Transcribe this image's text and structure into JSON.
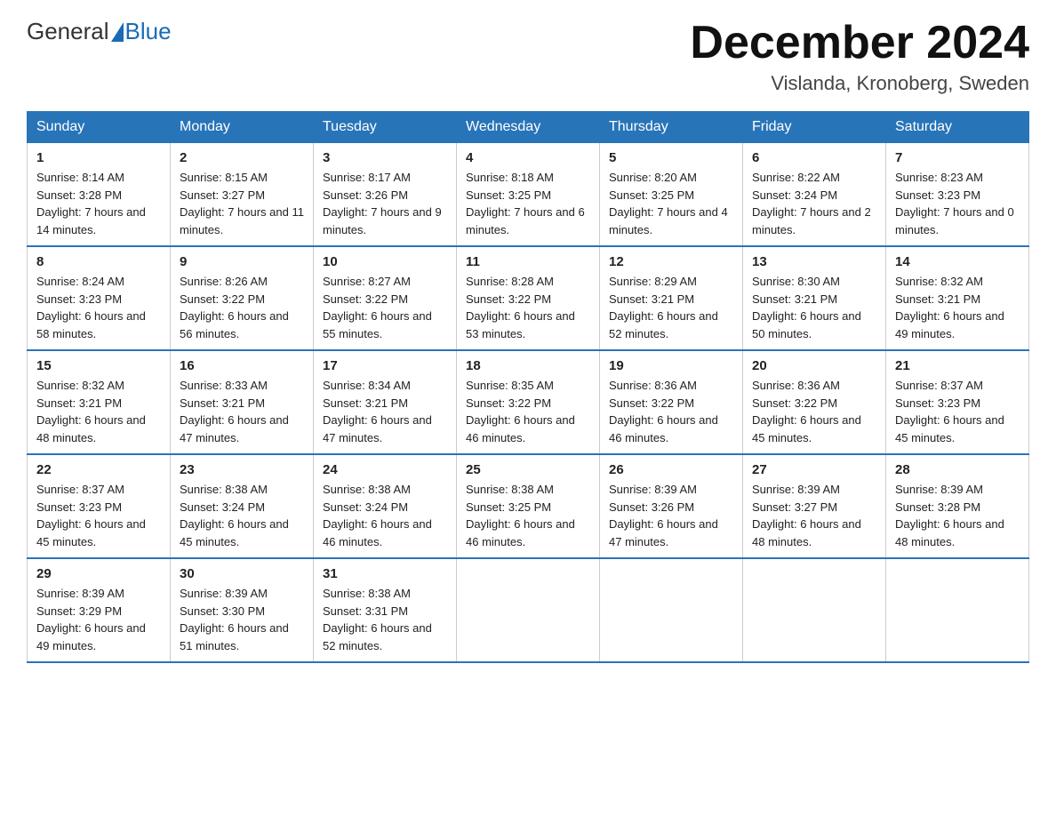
{
  "logo": {
    "general": "General",
    "blue": "Blue"
  },
  "title": "December 2024",
  "location": "Vislanda, Kronoberg, Sweden",
  "days_of_week": [
    "Sunday",
    "Monday",
    "Tuesday",
    "Wednesday",
    "Thursday",
    "Friday",
    "Saturday"
  ],
  "weeks": [
    [
      {
        "day": "1",
        "sunrise": "8:14 AM",
        "sunset": "3:28 PM",
        "daylight": "7 hours and 14 minutes."
      },
      {
        "day": "2",
        "sunrise": "8:15 AM",
        "sunset": "3:27 PM",
        "daylight": "7 hours and 11 minutes."
      },
      {
        "day": "3",
        "sunrise": "8:17 AM",
        "sunset": "3:26 PM",
        "daylight": "7 hours and 9 minutes."
      },
      {
        "day": "4",
        "sunrise": "8:18 AM",
        "sunset": "3:25 PM",
        "daylight": "7 hours and 6 minutes."
      },
      {
        "day": "5",
        "sunrise": "8:20 AM",
        "sunset": "3:25 PM",
        "daylight": "7 hours and 4 minutes."
      },
      {
        "day": "6",
        "sunrise": "8:22 AM",
        "sunset": "3:24 PM",
        "daylight": "7 hours and 2 minutes."
      },
      {
        "day": "7",
        "sunrise": "8:23 AM",
        "sunset": "3:23 PM",
        "daylight": "7 hours and 0 minutes."
      }
    ],
    [
      {
        "day": "8",
        "sunrise": "8:24 AM",
        "sunset": "3:23 PM",
        "daylight": "6 hours and 58 minutes."
      },
      {
        "day": "9",
        "sunrise": "8:26 AM",
        "sunset": "3:22 PM",
        "daylight": "6 hours and 56 minutes."
      },
      {
        "day": "10",
        "sunrise": "8:27 AM",
        "sunset": "3:22 PM",
        "daylight": "6 hours and 55 minutes."
      },
      {
        "day": "11",
        "sunrise": "8:28 AM",
        "sunset": "3:22 PM",
        "daylight": "6 hours and 53 minutes."
      },
      {
        "day": "12",
        "sunrise": "8:29 AM",
        "sunset": "3:21 PM",
        "daylight": "6 hours and 52 minutes."
      },
      {
        "day": "13",
        "sunrise": "8:30 AM",
        "sunset": "3:21 PM",
        "daylight": "6 hours and 50 minutes."
      },
      {
        "day": "14",
        "sunrise": "8:32 AM",
        "sunset": "3:21 PM",
        "daylight": "6 hours and 49 minutes."
      }
    ],
    [
      {
        "day": "15",
        "sunrise": "8:32 AM",
        "sunset": "3:21 PM",
        "daylight": "6 hours and 48 minutes."
      },
      {
        "day": "16",
        "sunrise": "8:33 AM",
        "sunset": "3:21 PM",
        "daylight": "6 hours and 47 minutes."
      },
      {
        "day": "17",
        "sunrise": "8:34 AM",
        "sunset": "3:21 PM",
        "daylight": "6 hours and 47 minutes."
      },
      {
        "day": "18",
        "sunrise": "8:35 AM",
        "sunset": "3:22 PM",
        "daylight": "6 hours and 46 minutes."
      },
      {
        "day": "19",
        "sunrise": "8:36 AM",
        "sunset": "3:22 PM",
        "daylight": "6 hours and 46 minutes."
      },
      {
        "day": "20",
        "sunrise": "8:36 AM",
        "sunset": "3:22 PM",
        "daylight": "6 hours and 45 minutes."
      },
      {
        "day": "21",
        "sunrise": "8:37 AM",
        "sunset": "3:23 PM",
        "daylight": "6 hours and 45 minutes."
      }
    ],
    [
      {
        "day": "22",
        "sunrise": "8:37 AM",
        "sunset": "3:23 PM",
        "daylight": "6 hours and 45 minutes."
      },
      {
        "day": "23",
        "sunrise": "8:38 AM",
        "sunset": "3:24 PM",
        "daylight": "6 hours and 45 minutes."
      },
      {
        "day": "24",
        "sunrise": "8:38 AM",
        "sunset": "3:24 PM",
        "daylight": "6 hours and 46 minutes."
      },
      {
        "day": "25",
        "sunrise": "8:38 AM",
        "sunset": "3:25 PM",
        "daylight": "6 hours and 46 minutes."
      },
      {
        "day": "26",
        "sunrise": "8:39 AM",
        "sunset": "3:26 PM",
        "daylight": "6 hours and 47 minutes."
      },
      {
        "day": "27",
        "sunrise": "8:39 AM",
        "sunset": "3:27 PM",
        "daylight": "6 hours and 48 minutes."
      },
      {
        "day": "28",
        "sunrise": "8:39 AM",
        "sunset": "3:28 PM",
        "daylight": "6 hours and 48 minutes."
      }
    ],
    [
      {
        "day": "29",
        "sunrise": "8:39 AM",
        "sunset": "3:29 PM",
        "daylight": "6 hours and 49 minutes."
      },
      {
        "day": "30",
        "sunrise": "8:39 AM",
        "sunset": "3:30 PM",
        "daylight": "6 hours and 51 minutes."
      },
      {
        "day": "31",
        "sunrise": "8:38 AM",
        "sunset": "3:31 PM",
        "daylight": "6 hours and 52 minutes."
      },
      null,
      null,
      null,
      null
    ]
  ]
}
